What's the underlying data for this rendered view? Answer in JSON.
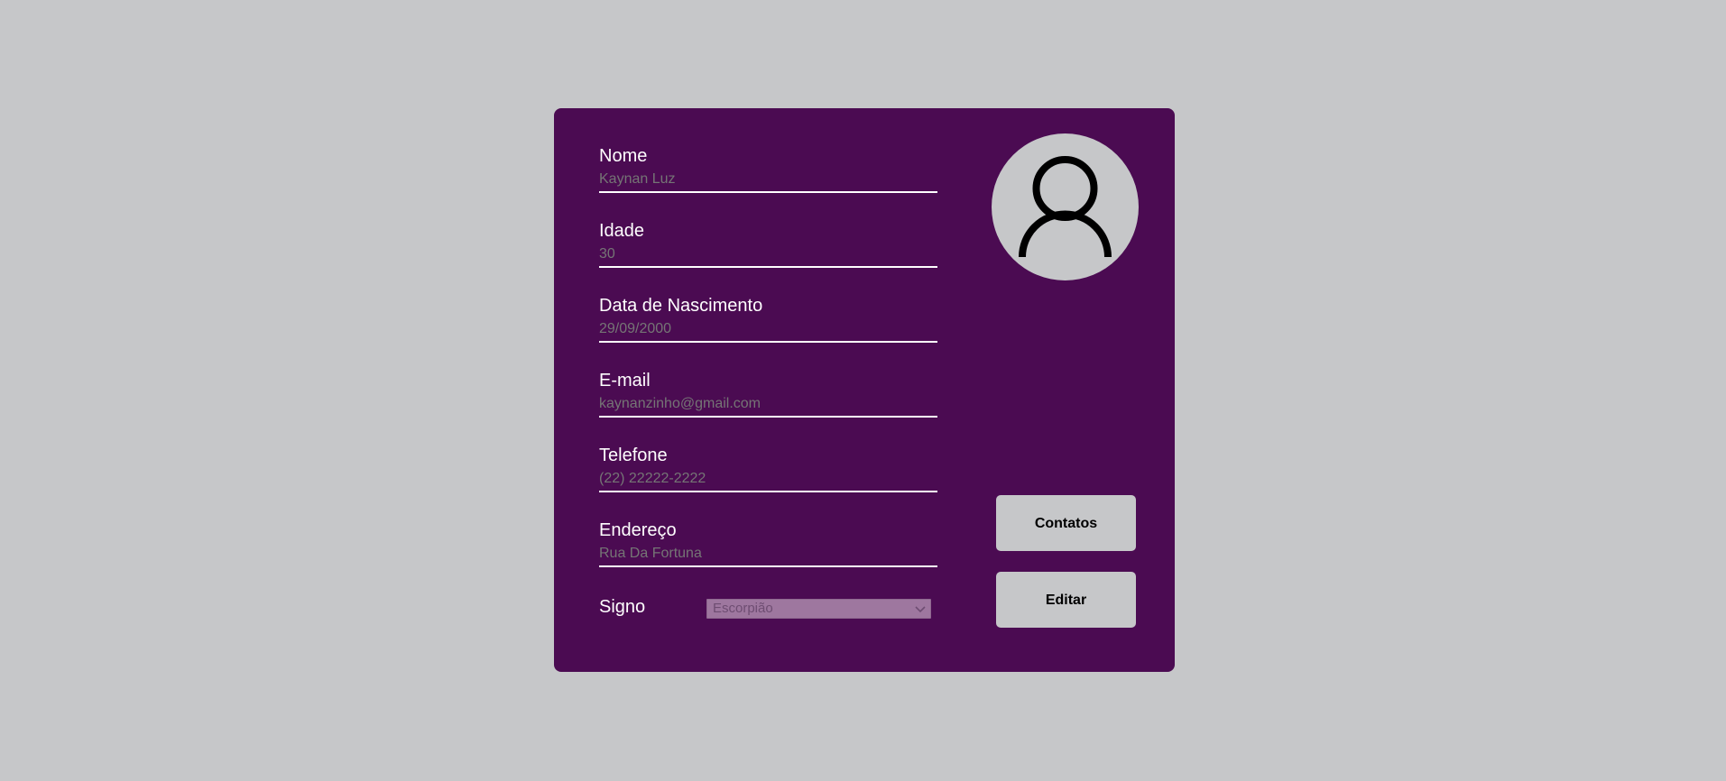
{
  "colors": {
    "background": "#c6c7c9",
    "card": "#4b0b52",
    "label_text": "#ffffff",
    "placeholder_text": "#a38aa7",
    "button_bg": "#c6c7c9"
  },
  "form": {
    "fields": [
      {
        "label": "Nome",
        "placeholder": "Kaynan Luz"
      },
      {
        "label": "Idade",
        "placeholder": "30"
      },
      {
        "label": "Data de Nascimento",
        "placeholder": "29/09/2000"
      },
      {
        "label": "E-mail",
        "placeholder": "kaynanzinho@gmail.com"
      },
      {
        "label": "Telefone",
        "placeholder": "(22) 22222-2222"
      },
      {
        "label": "Endereço",
        "placeholder": "Rua Da Fortuna"
      }
    ],
    "signo": {
      "label": "Signo",
      "selected": "Escorpião",
      "icon": "chevron-down-icon"
    }
  },
  "avatar": {
    "icon": "user-icon"
  },
  "buttons": {
    "contatos": "Contatos",
    "editar": "Editar"
  }
}
